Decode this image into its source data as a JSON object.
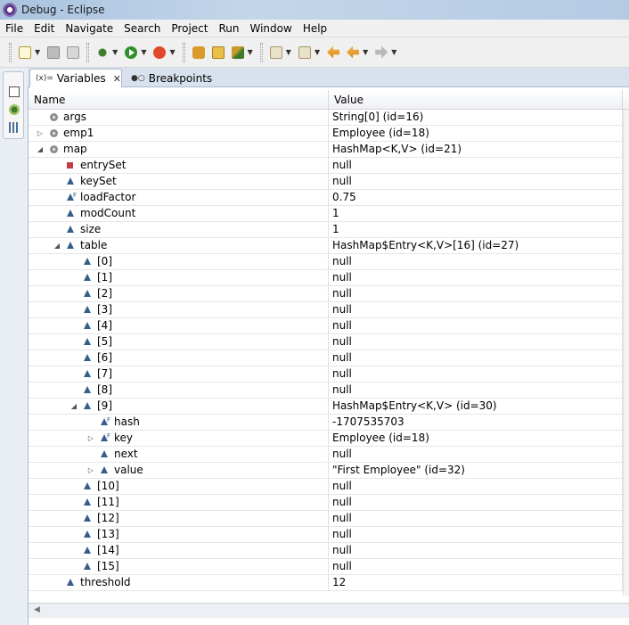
{
  "window": {
    "title": "Debug - Eclipse"
  },
  "menu": [
    "File",
    "Edit",
    "Navigate",
    "Search",
    "Project",
    "Run",
    "Window",
    "Help"
  ],
  "tabs": [
    {
      "label": "Variables",
      "active": true,
      "icon": "(x)="
    },
    {
      "label": "Breakpoints",
      "active": false,
      "icon": "●○"
    }
  ],
  "columns": {
    "name": "Name",
    "value": "Value"
  },
  "rows": [
    {
      "name": "args",
      "value": "String[0]  (id=16)",
      "depth": 0,
      "expander": "",
      "icon": "local"
    },
    {
      "name": "emp1",
      "value": "Employee  (id=18)",
      "depth": 0,
      "expander": "▷",
      "icon": "local"
    },
    {
      "name": "map",
      "value": "HashMap<K,V>  (id=21)",
      "depth": 0,
      "expander": "◢",
      "icon": "local"
    },
    {
      "name": "entrySet",
      "value": "null",
      "depth": 1,
      "expander": "",
      "icon": "field-sq"
    },
    {
      "name": "keySet",
      "value": "null",
      "depth": 1,
      "expander": "",
      "icon": "field"
    },
    {
      "name": "loadFactor",
      "value": "0.75",
      "depth": 1,
      "expander": "",
      "icon": "field-final"
    },
    {
      "name": "modCount",
      "value": "1",
      "depth": 1,
      "expander": "",
      "icon": "field"
    },
    {
      "name": "size",
      "value": "1",
      "depth": 1,
      "expander": "",
      "icon": "field"
    },
    {
      "name": "table",
      "value": "HashMap$Entry<K,V>[16]  (id=27)",
      "depth": 1,
      "expander": "◢",
      "icon": "field"
    },
    {
      "name": "[0]",
      "value": "null",
      "depth": 2,
      "expander": "",
      "icon": "field"
    },
    {
      "name": "[1]",
      "value": "null",
      "depth": 2,
      "expander": "",
      "icon": "field"
    },
    {
      "name": "[2]",
      "value": "null",
      "depth": 2,
      "expander": "",
      "icon": "field"
    },
    {
      "name": "[3]",
      "value": "null",
      "depth": 2,
      "expander": "",
      "icon": "field"
    },
    {
      "name": "[4]",
      "value": "null",
      "depth": 2,
      "expander": "",
      "icon": "field"
    },
    {
      "name": "[5]",
      "value": "null",
      "depth": 2,
      "expander": "",
      "icon": "field"
    },
    {
      "name": "[6]",
      "value": "null",
      "depth": 2,
      "expander": "",
      "icon": "field"
    },
    {
      "name": "[7]",
      "value": "null",
      "depth": 2,
      "expander": "",
      "icon": "field"
    },
    {
      "name": "[8]",
      "value": "null",
      "depth": 2,
      "expander": "",
      "icon": "field"
    },
    {
      "name": "[9]",
      "value": "HashMap$Entry<K,V>  (id=30)",
      "depth": 2,
      "expander": "◢",
      "icon": "field"
    },
    {
      "name": "hash",
      "value": "-1707535703",
      "depth": 3,
      "expander": "",
      "icon": "field-final"
    },
    {
      "name": "key",
      "value": "Employee  (id=18)",
      "depth": 3,
      "expander": "▷",
      "icon": "field-final"
    },
    {
      "name": "next",
      "value": "null",
      "depth": 3,
      "expander": "",
      "icon": "field"
    },
    {
      "name": "value",
      "value": "\"First Employee\" (id=32)",
      "depth": 3,
      "expander": "▷",
      "icon": "field"
    },
    {
      "name": "[10]",
      "value": "null",
      "depth": 2,
      "expander": "",
      "icon": "field"
    },
    {
      "name": "[11]",
      "value": "null",
      "depth": 2,
      "expander": "",
      "icon": "field"
    },
    {
      "name": "[12]",
      "value": "null",
      "depth": 2,
      "expander": "",
      "icon": "field"
    },
    {
      "name": "[13]",
      "value": "null",
      "depth": 2,
      "expander": "",
      "icon": "field"
    },
    {
      "name": "[14]",
      "value": "null",
      "depth": 2,
      "expander": "",
      "icon": "field"
    },
    {
      "name": "[15]",
      "value": "null",
      "depth": 2,
      "expander": "",
      "icon": "field"
    },
    {
      "name": "threshold",
      "value": "12",
      "depth": 1,
      "expander": "",
      "icon": "field"
    }
  ]
}
